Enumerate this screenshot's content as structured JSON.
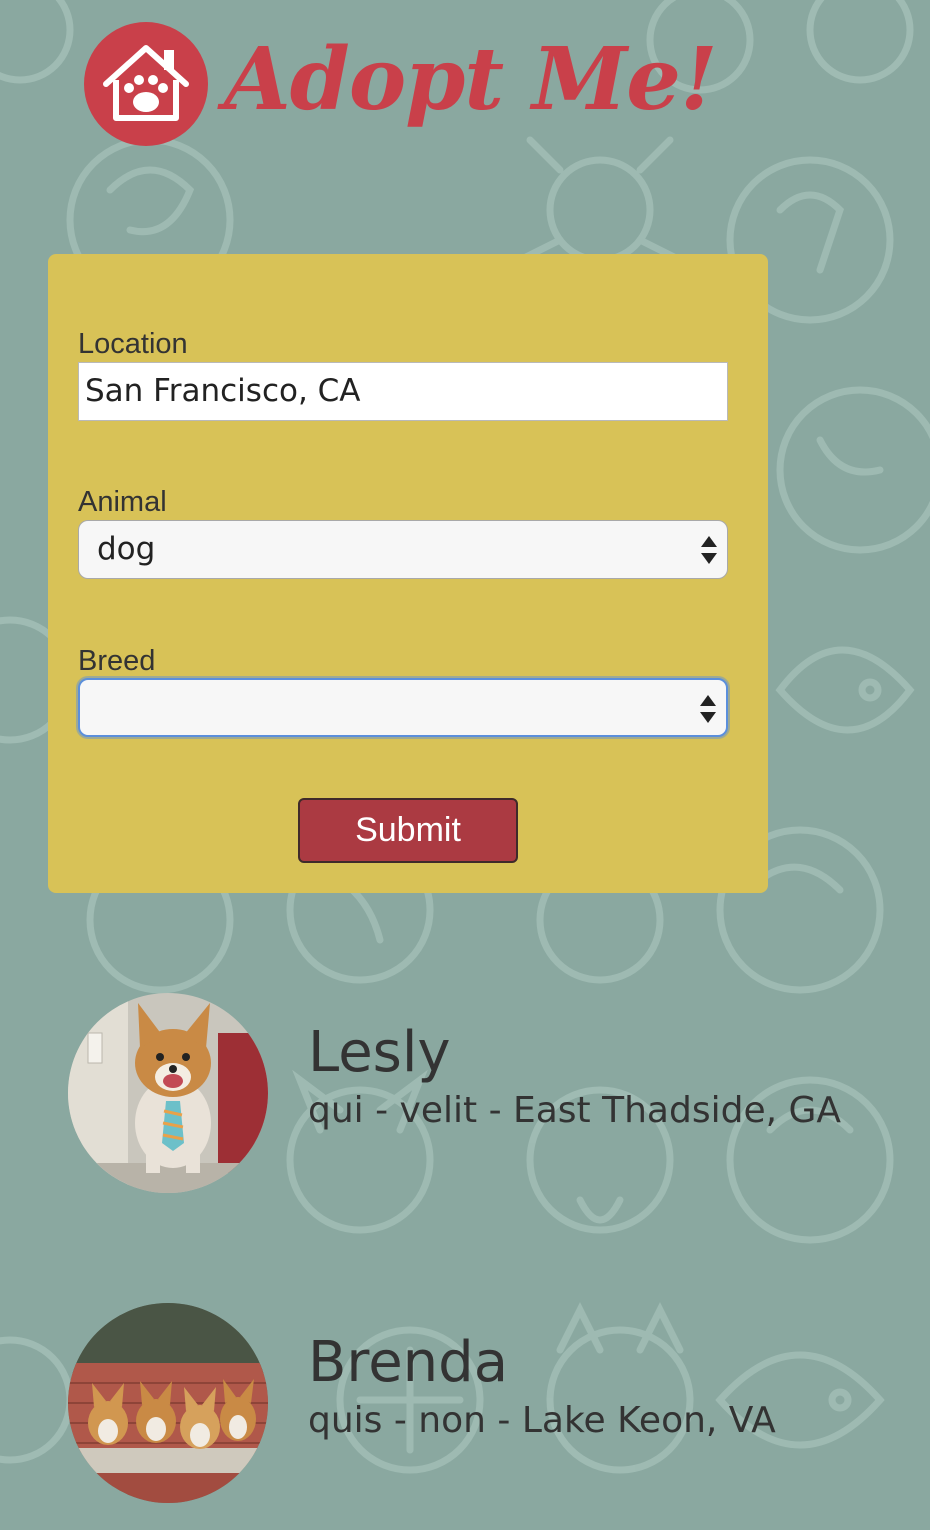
{
  "header": {
    "logo_text": "Adopt Me!",
    "logo_icon": "house-paw-icon",
    "brand_color": "#c9404a"
  },
  "search": {
    "location_label": "Location",
    "location_value": "San Francisco, CA",
    "animal_label": "Animal",
    "animal_value": "dog",
    "breed_label": "Breed",
    "breed_value": "",
    "submit_label": "Submit"
  },
  "pets": [
    {
      "name": "Lesly",
      "info": "qui - velit - East Thadside, GA",
      "photo": "corgi-with-tie"
    },
    {
      "name": "Brenda",
      "info": "quis - non - Lake Keon, VA",
      "photo": "four-corgis"
    }
  ],
  "colors": {
    "background": "#8aa8a0",
    "panel": "#d8c257",
    "button": "#ab3a42",
    "focus": "#5b8fdc"
  }
}
